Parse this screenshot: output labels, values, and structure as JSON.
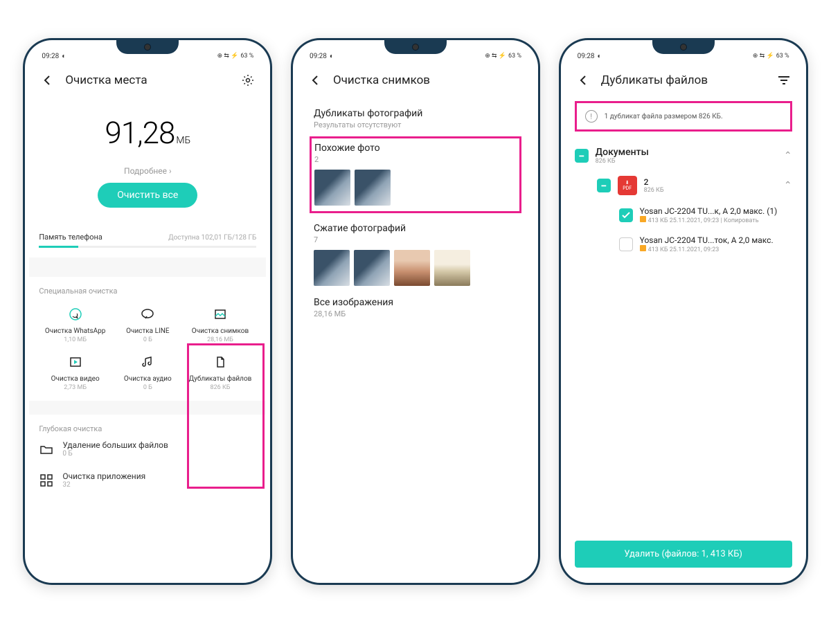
{
  "status": {
    "time": "09:28",
    "battery": "63 %"
  },
  "s1": {
    "title": "Очистка места",
    "size_value": "91,28",
    "size_unit": "МБ",
    "more": "Подробнее",
    "clean_all": "Очистить все",
    "mem_label": "Память телефона",
    "mem_avail": "Доступна 102,01 ГБ/128 ГБ",
    "special_title": "Специальная очистка",
    "grid": [
      {
        "t": "Очистка WhatsApp",
        "s": "1,10 МБ"
      },
      {
        "t": "Очистка LINE",
        "s": "0 Б"
      },
      {
        "t": "Очистка снимков",
        "s": "28,16 МБ"
      },
      {
        "t": "Очистка видео",
        "s": "2,73 МБ"
      },
      {
        "t": "Очистка аудио",
        "s": "0 Б"
      },
      {
        "t": "Дубликаты файлов",
        "s": "826 КБ"
      }
    ],
    "deep_title": "Глубокая очистка",
    "big_files": {
      "t": "Удаление больших файлов",
      "s": "0 Б"
    },
    "apps": {
      "t": "Очистка приложения",
      "s": "32"
    }
  },
  "s2": {
    "title": "Очистка снимков",
    "dup": {
      "t": "Дубликаты фотографий",
      "s": "Результаты отсутствуют"
    },
    "similar": {
      "t": "Похожие фото",
      "s": "2"
    },
    "compress": {
      "t": "Сжатие фотографий",
      "s": "7"
    },
    "all": {
      "t": "Все изображения",
      "s": "28,16 МБ"
    }
  },
  "s3": {
    "title": "Дубликаты файлов",
    "banner": "1 дубликат файла размером 826 КБ.",
    "docs": {
      "t": "Документы",
      "s": "826 КБ"
    },
    "group": {
      "t": "2",
      "s": "826 КБ"
    },
    "f1": {
      "t": "Yosan JC-2204 TU...к, A 2,0 макс. (1)",
      "s": "413 КБ 25.11.2021, 09:23  |  Копировать"
    },
    "f2": {
      "t": "Yosan JC-2204 TU...ток, A 2,0 макс.",
      "s": "413 КБ 25.11.2021, 09:23"
    },
    "delete": "Удалить (файлов: 1, 413 КБ)"
  }
}
